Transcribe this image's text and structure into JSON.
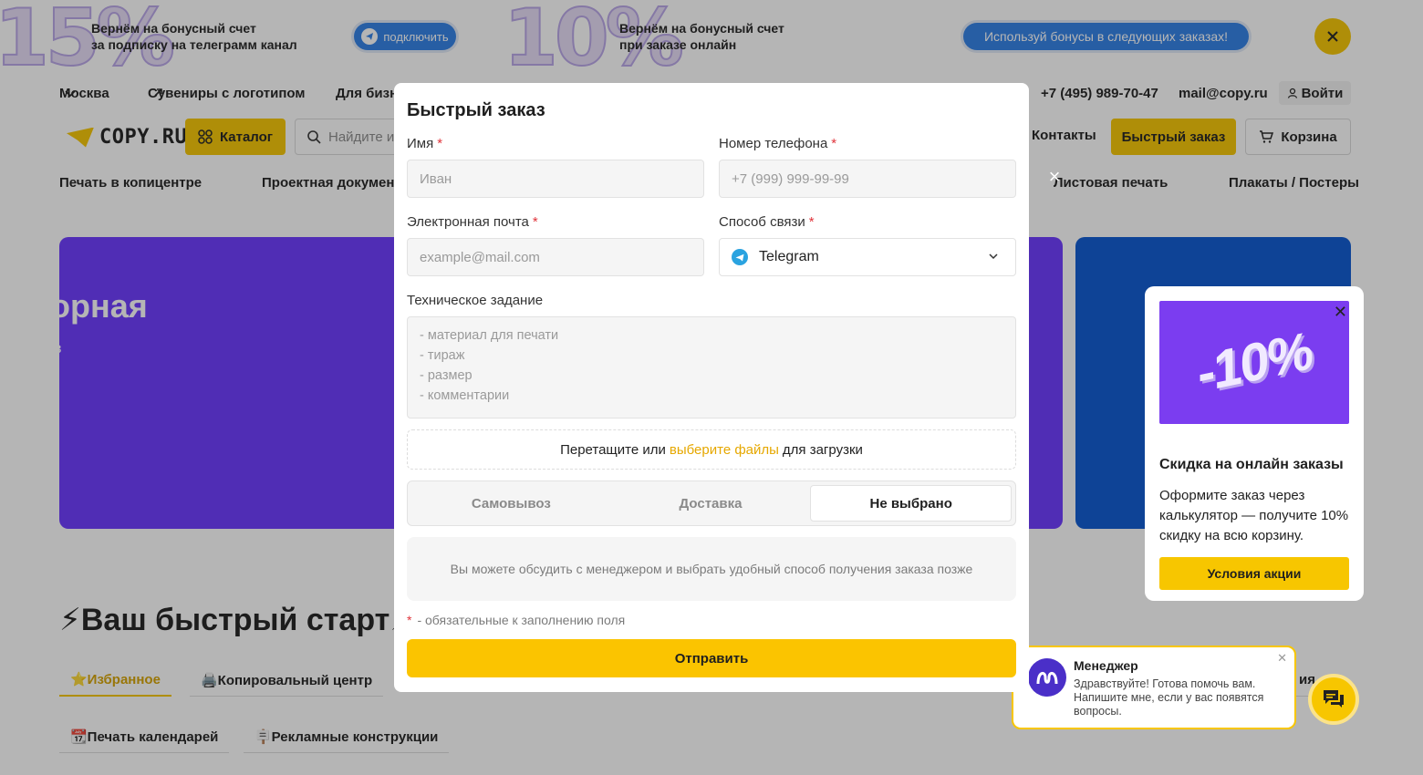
{
  "promo": {
    "left_badge": "15%",
    "left_text_line1": "Вернём на бонусный счет",
    "left_text_line2": "за подписку на телеграмм канал",
    "left_button": "подключить",
    "right_badge": "10%",
    "right_text_line1": "Вернём на бонусный счет",
    "right_text_line2": "при заказе онлайн",
    "right_button": "Используй бонусы в следующих заказах!"
  },
  "topnav": {
    "city": "Москва",
    "souvenirs": "Сувениры с логотипом",
    "business": "Для бизн",
    "phone": "+7 (495) 989-70-47",
    "email": "mail@copy.ru",
    "login": "Войти"
  },
  "header": {
    "logo": "COPY.RU",
    "catalog": "Каталог",
    "search_placeholder": "Найдите из",
    "contacts": "Контакты",
    "quick_order": "Быстрый заказ",
    "cart": "Корзина"
  },
  "catnav": {
    "items": [
      "Печать в копицентре",
      "Проектная документ",
      "Листовая печать",
      "Плакаты / Постеры"
    ]
  },
  "hero": {
    "title": "орная",
    "subtitle": "в"
  },
  "quickstart": {
    "title": "⚡Ваш быстрый старт",
    "title_tail": "⚡",
    "tabs": [
      "⭐Избранное",
      "🖨️Копировальный центр",
      "📆Печать календарей",
      "🪧Рекламные конструкции"
    ],
    "partial_tab": "ия"
  },
  "modal": {
    "title": "Быстрый заказ",
    "close": "×",
    "name_label": "Имя",
    "name_placeholder": "Иван",
    "phone_label": "Номер телефона",
    "phone_placeholder": "+7 (999) 999-99-99",
    "email_label": "Электронная почта",
    "email_placeholder": "example@mail.com",
    "contact_label": "Способ связи",
    "contact_value": "Telegram",
    "required_mark": "*",
    "tz_label": "Техническое задание",
    "tz_placeholder_lines": [
      "- материал для печати",
      "- тираж",
      "- размер",
      "- комментарии"
    ],
    "drop_text_before": "Перетащите или",
    "drop_link": "выберите файлы",
    "drop_text_after": "для загрузки",
    "delivery_options": [
      "Самовывоз",
      "Доставка",
      "Не выбрано"
    ],
    "delivery_selected": "Не выбрано",
    "delivery_note": "Вы можете обсудить с менеджером и выбрать удобный способ получения заказа позже",
    "required_note": "- обязательные к заполнению поля",
    "submit": "Отправить"
  },
  "promo_card": {
    "badge": "-10%",
    "close": "✕",
    "title": "Скидка на онлайн заказы",
    "text": "Оформите заказ через калькулятор — получите 10% скидку на всю корзину.",
    "button": "Условия акции"
  },
  "chat": {
    "name": "Менеджер",
    "message": "Здравствуйте! Готова помочь вам. Напишите мне, если у вас появятся вопросы.",
    "close": "✕"
  },
  "colors": {
    "accent": "#f7c600",
    "hero_purple": "#6a37ff",
    "hero_blue": "#0a57d2",
    "required": "#e0343b",
    "link": "#e6a800"
  }
}
